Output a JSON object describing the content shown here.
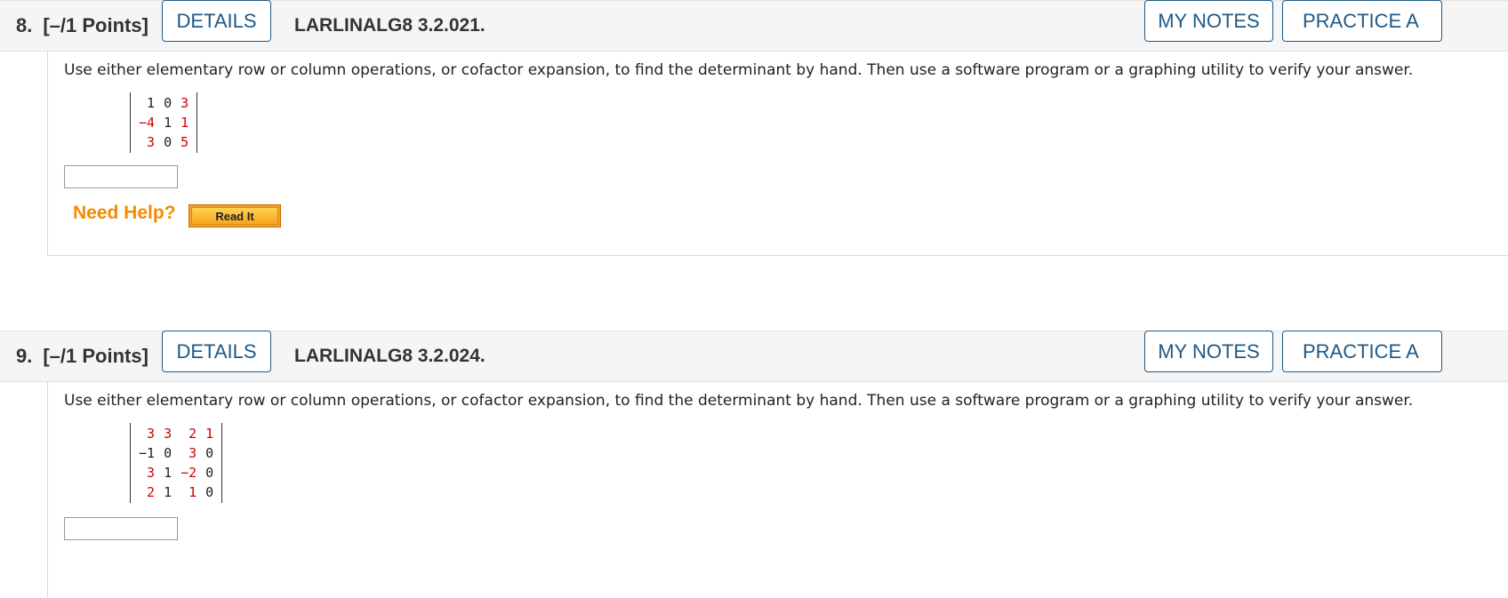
{
  "questions": [
    {
      "number": "8.",
      "points": "[–/1 Points]",
      "details_label": "DETAILS",
      "code": "LARLINALG8 3.2.021.",
      "my_notes_label": "MY NOTES",
      "practice_label": "PRACTICE A",
      "prompt": "Use either elementary row or column operations, or cofactor expansion, to find the determinant by hand. Then use a software program or a graphing utility to verify your answer.",
      "matrix": [
        [
          "1",
          "0",
          "3"
        ],
        [
          "−4",
          "1",
          "1"
        ],
        [
          "3",
          "0",
          "5"
        ]
      ],
      "answer_value": "",
      "need_help_label": "Need Help?",
      "read_it_label": "Read It"
    },
    {
      "number": "9.",
      "points": "[–/1 Points]",
      "details_label": "DETAILS",
      "code": "LARLINALG8 3.2.024.",
      "my_notes_label": "MY NOTES",
      "practice_label": "PRACTICE A",
      "prompt": "Use either elementary row or column operations, or cofactor expansion, to find the determinant by hand. Then use a software program or a graphing utility to verify your answer.",
      "matrix": [
        [
          "3",
          "3",
          "2",
          "1"
        ],
        [
          "−1",
          "0",
          "3",
          "0"
        ],
        [
          "3",
          "1",
          "−2",
          "0"
        ],
        [
          "2",
          "1",
          "1",
          "0"
        ]
      ],
      "answer_value": ""
    }
  ],
  "colors": {
    "red_entry": "#d00000",
    "black_entry": "#222222",
    "link_blue": "#1f5a86",
    "help_orange": "#f28c00"
  }
}
